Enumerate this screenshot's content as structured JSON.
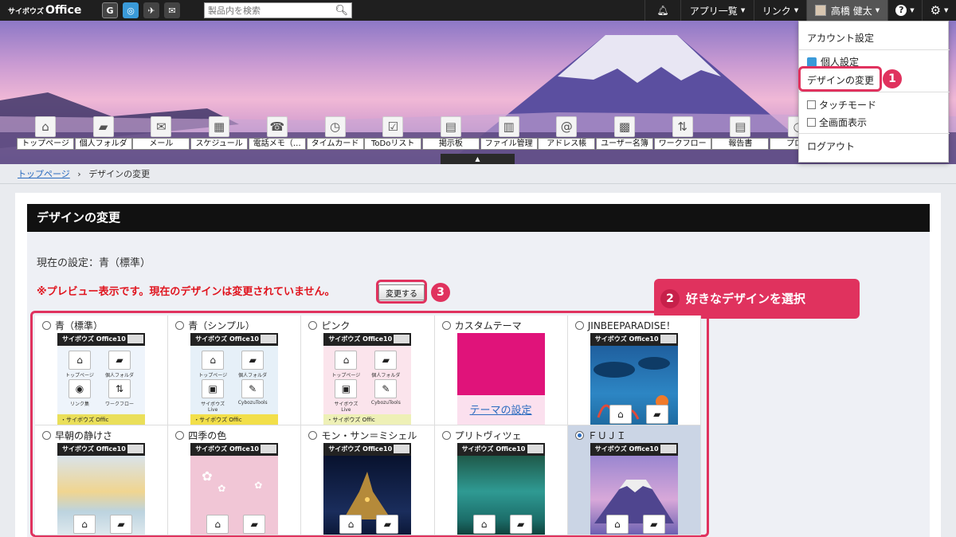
{
  "topbar": {
    "logo_small": "サイボウズ",
    "logo": "Office",
    "search_placeholder": "製品内を検索",
    "apps_menu": "アプリ一覧",
    "link_menu": "リンク",
    "user_name": "高橋 健太",
    "help_icon": "question-icon",
    "settings_icon": "gear-icon"
  },
  "apps": [
    {
      "label": "トップページ",
      "icon": "home-icon"
    },
    {
      "label": "個人フォルダ",
      "icon": "folder-icon"
    },
    {
      "label": "メール",
      "icon": "mail-icon"
    },
    {
      "label": "スケジュール",
      "icon": "calendar-icon"
    },
    {
      "label": "電話メモ（…",
      "icon": "phone-icon"
    },
    {
      "label": "タイムカード",
      "icon": "timecard-icon"
    },
    {
      "label": "ToDoリスト",
      "icon": "todo-icon"
    },
    {
      "label": "掲示板",
      "icon": "board-icon"
    },
    {
      "label": "ファイル管理",
      "icon": "file-icon"
    },
    {
      "label": "アドレス帳",
      "icon": "address-icon"
    },
    {
      "label": "ユーザー名簿",
      "icon": "roster-icon"
    },
    {
      "label": "ワークフロー",
      "icon": "workflow-icon"
    },
    {
      "label": "報告書",
      "icon": "report-icon"
    },
    {
      "label": "プロジ",
      "icon": "project-icon"
    }
  ],
  "breadcrumb": {
    "home": "トップページ",
    "sep": "›",
    "current": "デザインの変更"
  },
  "panel": {
    "title": "デザインの変更",
    "current_setting": "現在の設定：青（標準）",
    "preview_warning": "※プレビュー表示です。現在のデザインは変更されていません。",
    "change_button": "変更する"
  },
  "callouts": {
    "step1": "1",
    "step2": "2",
    "step2_text": "好きなデザインを選択",
    "step3": "3"
  },
  "designs": [
    {
      "name": "青（標準）",
      "selected": false,
      "theme": "blue"
    },
    {
      "name": "青（シンプル）",
      "selected": false,
      "theme": "simple"
    },
    {
      "name": "ピンク",
      "selected": false,
      "theme": "pink"
    },
    {
      "name": "カスタムテーマ",
      "selected": false,
      "theme": "custom"
    },
    {
      "name": "JINBEEPARADISE！",
      "selected": false,
      "theme": "ocean"
    },
    {
      "name": "早朝の静けさ",
      "selected": false,
      "theme": "dawn"
    },
    {
      "name": "四季の色",
      "selected": false,
      "theme": "sakura"
    },
    {
      "name": "モン・サン＝ミシェル",
      "selected": false,
      "theme": "night"
    },
    {
      "name": "プリトヴィツェ",
      "selected": false,
      "theme": "lake"
    },
    {
      "name": "ＦＵＪＩ",
      "selected": true,
      "theme": "fuji"
    }
  ],
  "thumb_text": {
    "product": "サイボウズ Office10",
    "top_page": "トップページ",
    "personal_folder": "個人フォルダ",
    "link": "リンク集",
    "workflow": "ワークフロー",
    "live": "サイボウズLive",
    "tools": "CybozuTools",
    "footer": "・サイボウズ Offic",
    "theme_settings": "テーマの設定"
  },
  "user_menu": {
    "account": "アカウント設定",
    "personal": "個人設定",
    "design": "デザインの変更",
    "touch": "タッチモード",
    "fullscreen": "全画面表示",
    "logout": "ログアウト"
  },
  "colors": {
    "accent": "#e0325e",
    "warning": "#e0141e",
    "link": "#2a6bbf"
  }
}
